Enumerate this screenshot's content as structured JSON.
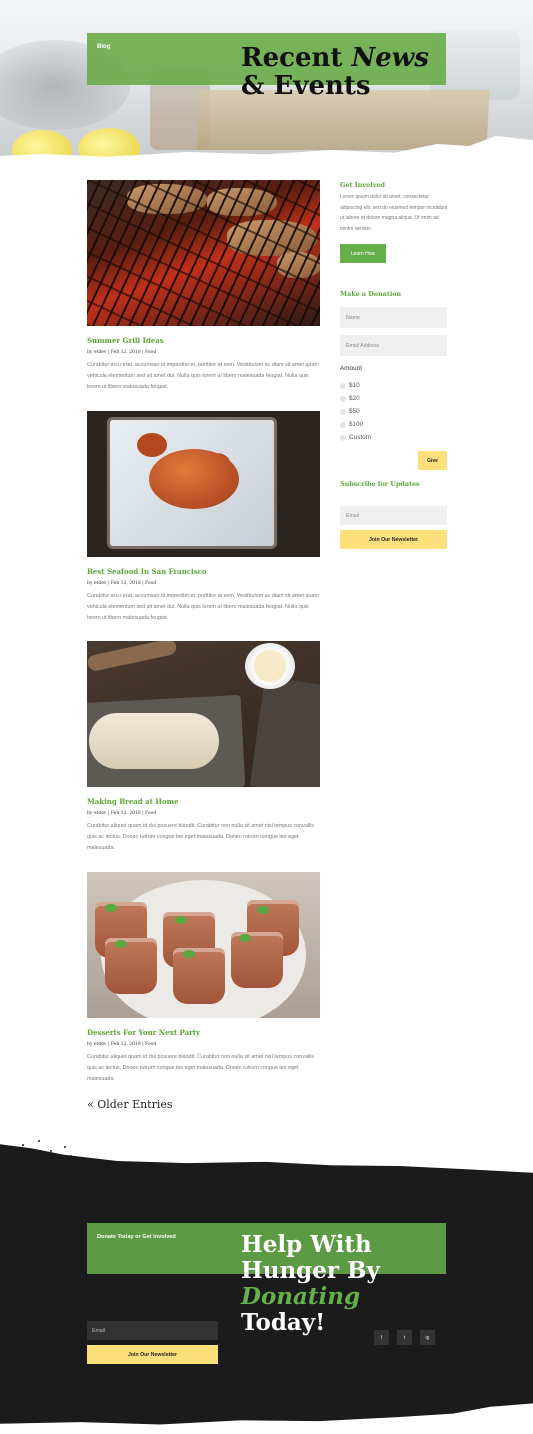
{
  "hero": {
    "label": "Blog",
    "title_part1": "Recent ",
    "title_bold": "News",
    "title_part2": " & Events"
  },
  "posts": [
    {
      "title": "Summer Grill Ideas",
      "meta": "by etdev | Feb 12, 2018 | Food",
      "excerpt": "Curabitur arcu erat, accumsan id imperdiet et, porttitor at sem. Vestibulum ac diam sit amet quam vehicula elementum sed sit amet dui. Nulla quis lorem ut libero malesuada feugiat. Nulla quis lorem ut libero malesuada feugiat."
    },
    {
      "title": "Best Seafood In San Francisco",
      "meta": "by etdev | Feb 12, 2018 | Food",
      "excerpt": "Curabitur arcu erat, accumsan id imperdiet et, porttitor at sem. Vestibulum ac diam sit amet quam vehicula elementum sed sit amet dui. Nulla quis lorem ut libero malesuada feugiat. Nulla quis lorem ut libero malesuada feugiat."
    },
    {
      "title": "Making Bread at Home",
      "meta": "by etdev | Feb 12, 2018 | Food",
      "excerpt": "Curabitur aliquet quam id dui posuere blandit. Curabitur non nulla sit amet nisl tempus convallis quis ac lectus. Donec rutrum congue leo eget malesuada. Donec rutrum congue leo eget malesuada."
    },
    {
      "title": "Desserts For Your Next Party",
      "meta": "by etdev | Feb 12, 2018 | Food",
      "excerpt": "Curabitur aliquet quam id dui posuere blandit. Curabitur non nulla sit amet nisl tempus convallis quis ac lectus. Donec rutrum congue leo eget malesuada. Donec rutrum congue leo eget malesuada."
    }
  ],
  "older_entries": "« Older Entries",
  "sidebar": {
    "get_involved": {
      "heading": "Get Involved",
      "text": "Lorem ipsum dolor sit amet, consectetur adipiscing elit, sed do eiusmod tempor incididunt ut labore et dolore magna aliqua. Ut enim ad minim veniam",
      "button": "Learn How"
    },
    "donation": {
      "heading": "Make a Donation",
      "name_placeholder": "Name",
      "email_placeholder": "Email Address",
      "amount_label": "Amount",
      "options": [
        "$10",
        "$20",
        "$50",
        "$100",
        "Custom"
      ],
      "button": "Give"
    },
    "subscribe": {
      "heading": "Subscribe for Updates",
      "email_placeholder": "Email",
      "button": "Join Our Newsletter"
    }
  },
  "footer": {
    "label": "Donate Today or Get Involved",
    "title_bold": "Help With Hunger",
    "title_mid": " By ",
    "title_italic": "Donating",
    "title_end": " Today!",
    "email_placeholder": "Email",
    "button": "Join Our Newsletter",
    "social": [
      "f",
      "t",
      "ig"
    ]
  },
  "colors": {
    "green": "#66b04a",
    "yellow": "#fde07c",
    "dark": "#1b1b1b"
  }
}
